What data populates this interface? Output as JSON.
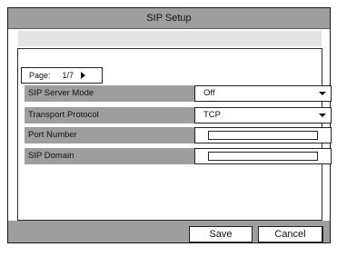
{
  "window": {
    "title": "SIP Setup"
  },
  "pager": {
    "label": "Page:",
    "value": "1/7"
  },
  "settings": [
    {
      "label": "SIP Server Mode",
      "value": "Off",
      "kind": "dropdown"
    },
    {
      "label": "Transport Protocol",
      "value": "TCP",
      "kind": "dropdown"
    },
    {
      "label": "Port Number",
      "value": "",
      "kind": "text"
    },
    {
      "label": "SIP Domain",
      "value": "",
      "kind": "text"
    }
  ],
  "buttons": {
    "save": "Save",
    "cancel": "Cancel"
  }
}
